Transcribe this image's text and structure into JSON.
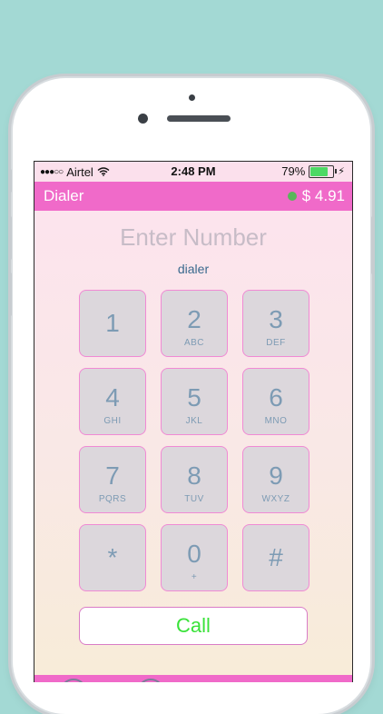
{
  "status_bar": {
    "signal_dots": "●●●○○",
    "carrier": "Airtel",
    "wifi_icon": "wifi-icon",
    "time": "2:48 PM",
    "battery_percent": "79%",
    "battery_level": 0.79,
    "charging_icon": "⚡"
  },
  "nav": {
    "title": "Dialer",
    "balance": "$ 4.91",
    "status_color": "#5ab55a"
  },
  "display": {
    "placeholder": "Enter Number",
    "subtitle": "dialer"
  },
  "keypad": [
    {
      "digit": "1",
      "letters": ""
    },
    {
      "digit": "2",
      "letters": "ABC"
    },
    {
      "digit": "3",
      "letters": "DEF"
    },
    {
      "digit": "4",
      "letters": "GHI"
    },
    {
      "digit": "5",
      "letters": "JKL"
    },
    {
      "digit": "6",
      "letters": "MNO"
    },
    {
      "digit": "7",
      "letters": "PQRS"
    },
    {
      "digit": "8",
      "letters": "TUV"
    },
    {
      "digit": "9",
      "letters": "WXYZ"
    },
    {
      "digit": "*",
      "letters": ""
    },
    {
      "digit": "0",
      "letters": "+"
    },
    {
      "digit": "#",
      "letters": ""
    }
  ],
  "call": {
    "label": "Call"
  },
  "colors": {
    "accent": "#f06ac9",
    "call_text": "#39e239",
    "key_text": "#7d9bb4",
    "background": "#a3d9d4"
  }
}
